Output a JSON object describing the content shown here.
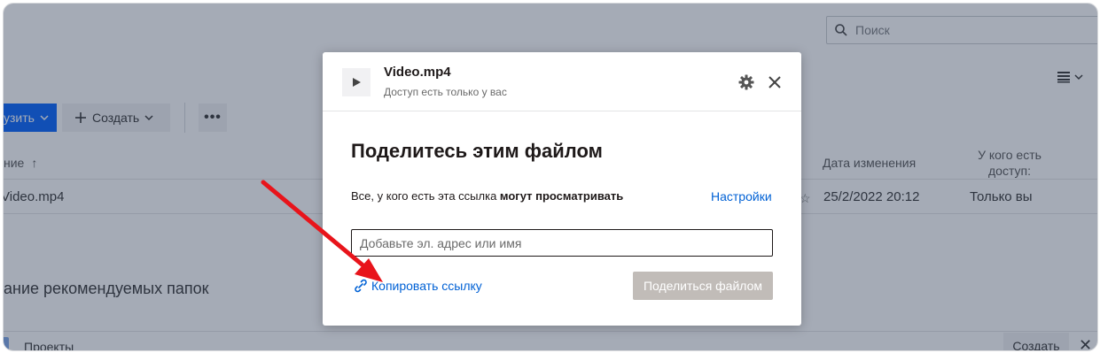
{
  "background": {
    "search_placeholder": "Поиск",
    "toolbar": {
      "upload_label": "узить",
      "create_label": "Создать"
    },
    "table": {
      "header_name": "ние",
      "header_date": "Дата изменения",
      "header_access": "У кого есть доступ:",
      "row": {
        "name": "Video.mp4",
        "date": "25/2/2022 20:12",
        "access": "Только вы"
      }
    },
    "suggested": {
      "title": "ание рекомендуемых папок",
      "folder_label": "Проекты",
      "create_label": "Создать"
    }
  },
  "modal": {
    "file_name": "Video.mp4",
    "access_note": "Доступ есть только у вас",
    "heading": "Поделитесь этим файлом",
    "permission_prefix": "Все, у кого есть эта ссылка",
    "permission_level": "могут просматривать",
    "settings_link": "Настройки",
    "email_placeholder": "Добавьте эл. адрес или имя",
    "copy_link_label": "Копировать ссылку",
    "share_button_label": "Поделиться файлом"
  },
  "colors": {
    "accent": "#0061d5",
    "primary_button": "#0061fe",
    "disabled_button": "#c1bcb8",
    "annotation_arrow": "#e8141b",
    "overlay": "rgba(40,56,80,0.42)"
  },
  "icons": [
    "search-icon",
    "list-view-icon",
    "chevron-down-icon",
    "plus-icon",
    "more-icon",
    "sort-arrow-icon",
    "star-icon",
    "play-icon",
    "gear-icon",
    "close-icon",
    "link-icon",
    "annotation-arrow"
  ]
}
